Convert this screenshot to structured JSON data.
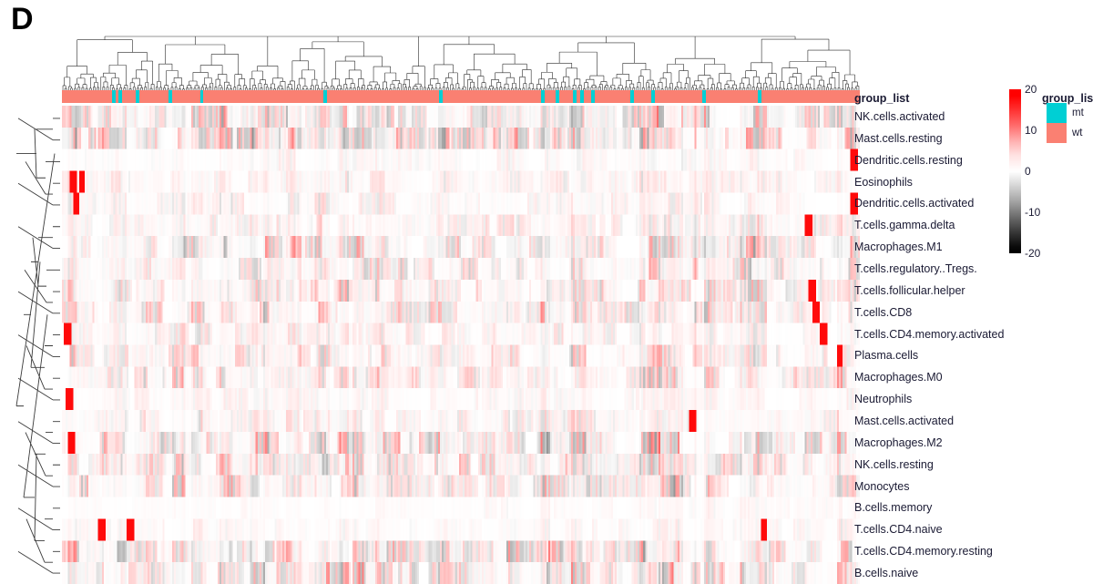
{
  "panel": {
    "label": "D"
  },
  "annotation": {
    "title": "group_list",
    "bar_color": "#FA8072",
    "mark_color": "#00CFD4",
    "mt_positions": [
      6.3,
      7.1,
      9.2,
      13.4,
      17.3,
      32.8,
      47.3,
      60.0,
      61.9,
      64.0,
      65.0,
      66.3,
      71.2,
      73.9,
      80.3,
      87.2
    ],
    "mt_width": 0.45
  },
  "legend_scale": {
    "max_color": "#FF0000",
    "mid_color": "#FFFFFF",
    "min_color": "#000000",
    "ticks": [
      {
        "label": "20",
        "pos": 0
      },
      {
        "label": "10",
        "pos": 25
      },
      {
        "label": "0",
        "pos": 50
      },
      {
        "label": "-10",
        "pos": 75
      },
      {
        "label": "-20",
        "pos": 100
      }
    ]
  },
  "legend_group": {
    "title": "group_list",
    "items": [
      {
        "label": "mt",
        "color": "#00CFD4"
      },
      {
        "label": "wt",
        "color": "#FA8072"
      }
    ]
  },
  "rows": [
    "NK.cells.activated",
    "Mast.cells.resting",
    "Dendritic.cells.resting",
    "Eosinophils",
    "Dendritic.cells.activated",
    "T.cells.gamma.delta",
    "Macrophages.M1",
    "T.cells.regulatory..Tregs.",
    "T.cells.follicular.helper",
    "T.cells.CD8",
    "T.cells.CD4.memory.activated",
    "Plasma.cells",
    "Macrophages.M0",
    "Neutrophils",
    "Mast.cells.activated",
    "Macrophages.M2",
    "NK.cells.resting",
    "Monocytes",
    "B.cells.memory",
    "T.cells.CD4.naive",
    "T.cells.CD4.memory.resting",
    "B.cells.naive"
  ],
  "chart_data": {
    "type": "heatmap",
    "title": "D",
    "xlabel": "",
    "ylabel": "",
    "n_columns": 420,
    "n_rows": 22,
    "value_range": [
      -20,
      20
    ],
    "colorbar_ticks": [
      20,
      10,
      0,
      -10,
      -20
    ],
    "colormap": "black-white-red (diverging, 0 = white)",
    "row_categories": [
      "NK.cells.activated",
      "Mast.cells.resting",
      "Dendritic.cells.resting",
      "Eosinophils",
      "Dendritic.cells.activated",
      "T.cells.gamma.delta",
      "Macrophages.M1",
      "T.cells.regulatory..Tregs.",
      "T.cells.follicular.helper",
      "T.cells.CD8",
      "T.cells.CD4.memory.activated",
      "Plasma.cells",
      "Macrophages.M0",
      "Neutrophils",
      "Mast.cells.activated",
      "Macrophages.M2",
      "NK.cells.resting",
      "Monocytes",
      "B.cells.memory",
      "T.cells.CD4.naive",
      "T.cells.CD4.memory.resting",
      "B.cells.naive"
    ],
    "column_annotation": {
      "name": "group_list",
      "levels": [
        "mt",
        "wt"
      ],
      "level_colors": {
        "mt": "#00CFD4",
        "wt": "#FA8072"
      },
      "dominant_level": "wt"
    },
    "row_dendrogram": true,
    "column_dendrogram": true,
    "row_profiles": [
      {
        "row": "NK.cells.activated",
        "baseline": 0.0,
        "activity": 0.55,
        "warm": 0.45,
        "hot_cols": []
      },
      {
        "row": "Mast.cells.resting",
        "baseline": 0.0,
        "activity": 0.62,
        "warm": 0.5,
        "hot_cols": []
      },
      {
        "row": "Dendritic.cells.resting",
        "baseline": 0.0,
        "activity": 0.12,
        "warm": 0.6,
        "hot_cols": [
          99.2
        ]
      },
      {
        "row": "Eosinophils",
        "baseline": 0.0,
        "activity": 0.2,
        "warm": 0.72,
        "hot_cols": [
          1.5,
          2.5
        ]
      },
      {
        "row": "Dendritic.cells.activated",
        "baseline": 0.0,
        "activity": 0.2,
        "warm": 0.7,
        "hot_cols": [
          1.8,
          99.2
        ]
      },
      {
        "row": "T.cells.gamma.delta",
        "baseline": 0.0,
        "activity": 0.3,
        "warm": 0.65,
        "hot_cols": [
          93.5
        ]
      },
      {
        "row": "Macrophages.M1",
        "baseline": 0.0,
        "activity": 0.52,
        "warm": 0.42,
        "hot_cols": []
      },
      {
        "row": "T.cells.regulatory..Tregs.",
        "baseline": 0.0,
        "activity": 0.45,
        "warm": 0.6,
        "hot_cols": []
      },
      {
        "row": "T.cells.follicular.helper",
        "baseline": 0.0,
        "activity": 0.42,
        "warm": 0.62,
        "hot_cols": [
          94.0
        ]
      },
      {
        "row": "T.cells.CD8",
        "baseline": 0.0,
        "activity": 0.46,
        "warm": 0.62,
        "hot_cols": [
          94.5
        ]
      },
      {
        "row": "T.cells.CD4.memory.activated",
        "baseline": 0.0,
        "activity": 0.22,
        "warm": 0.72,
        "hot_cols": [
          0.7,
          95.5
        ]
      },
      {
        "row": "Plasma.cells",
        "baseline": 0.0,
        "activity": 0.34,
        "warm": 0.68,
        "hot_cols": [
          97.5
        ]
      },
      {
        "row": "Macrophages.M0",
        "baseline": 0.0,
        "activity": 0.4,
        "warm": 0.66,
        "hot_cols": []
      },
      {
        "row": "Neutrophils",
        "baseline": 0.0,
        "activity": 0.14,
        "warm": 0.7,
        "hot_cols": [
          0.9
        ]
      },
      {
        "row": "Mast.cells.activated",
        "baseline": 0.0,
        "activity": 0.26,
        "warm": 0.6,
        "hot_cols": [
          79.0
        ]
      },
      {
        "row": "Macrophages.M2",
        "baseline": 0.0,
        "activity": 0.55,
        "warm": 0.5,
        "hot_cols": [
          1.1
        ]
      },
      {
        "row": "NK.cells.resting",
        "baseline": 0.0,
        "activity": 0.5,
        "warm": 0.6,
        "hot_cols": []
      },
      {
        "row": "Monocytes",
        "baseline": 0.0,
        "activity": 0.48,
        "warm": 0.55,
        "hot_cols": []
      },
      {
        "row": "B.cells.memory",
        "baseline": 0.0,
        "activity": 0.08,
        "warm": 0.75,
        "hot_cols": []
      },
      {
        "row": "T.cells.CD4.naive",
        "baseline": 0.0,
        "activity": 0.12,
        "warm": 0.72,
        "hot_cols": [
          5.0,
          8.5,
          88.0
        ]
      },
      {
        "row": "T.cells.CD4.memory.resting",
        "baseline": 0.0,
        "activity": 0.52,
        "warm": 0.55,
        "hot_cols": []
      },
      {
        "row": "B.cells.naive",
        "baseline": 0.0,
        "activity": 0.58,
        "warm": 0.52,
        "hot_cols": []
      }
    ]
  }
}
